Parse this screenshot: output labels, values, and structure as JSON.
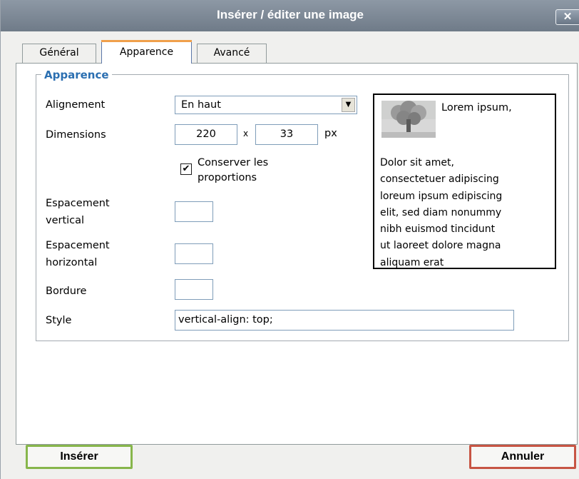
{
  "window": {
    "title": "Insérer / éditer une image",
    "close_label": "✕"
  },
  "tabs": [
    {
      "label": "Général",
      "active": false
    },
    {
      "label": "Apparence",
      "active": true
    },
    {
      "label": "Avancé",
      "active": false
    }
  ],
  "fieldset": {
    "legend": "Apparence",
    "alignment": {
      "label": "Alignement",
      "value": "En haut"
    },
    "dimensions": {
      "label": "Dimensions",
      "width": "220",
      "separator": "x",
      "height": "33",
      "unit": "px"
    },
    "constrain": {
      "checked": true,
      "label_line1": "Conserver les",
      "label_line2": "proportions"
    },
    "vspace": {
      "label_line1": "Espacement",
      "label_line2": "vertical",
      "value": ""
    },
    "hspace": {
      "label_line1": "Espacement",
      "label_line2": "horizontal",
      "value": ""
    },
    "border": {
      "label": "Bordure",
      "value": ""
    },
    "style": {
      "label": "Style",
      "value": "vertical-align: top;"
    }
  },
  "preview": {
    "first_line": "Lorem ipsum,",
    "lines": [
      "Dolor sit amet,",
      "consectetuer adipiscing",
      "loreum ipsum edipiscing",
      "elit, sed diam nonummy",
      "nibh euismod tincidunt",
      "ut laoreet dolore magna",
      "aliquam erat"
    ]
  },
  "buttons": {
    "insert": "Insérer",
    "cancel": "Annuler"
  },
  "colors": {
    "legend": "#2b6fb1",
    "insert_border": "#87b64b",
    "cancel_border": "#c75544",
    "active_tab_accent": "#f0a04b"
  }
}
